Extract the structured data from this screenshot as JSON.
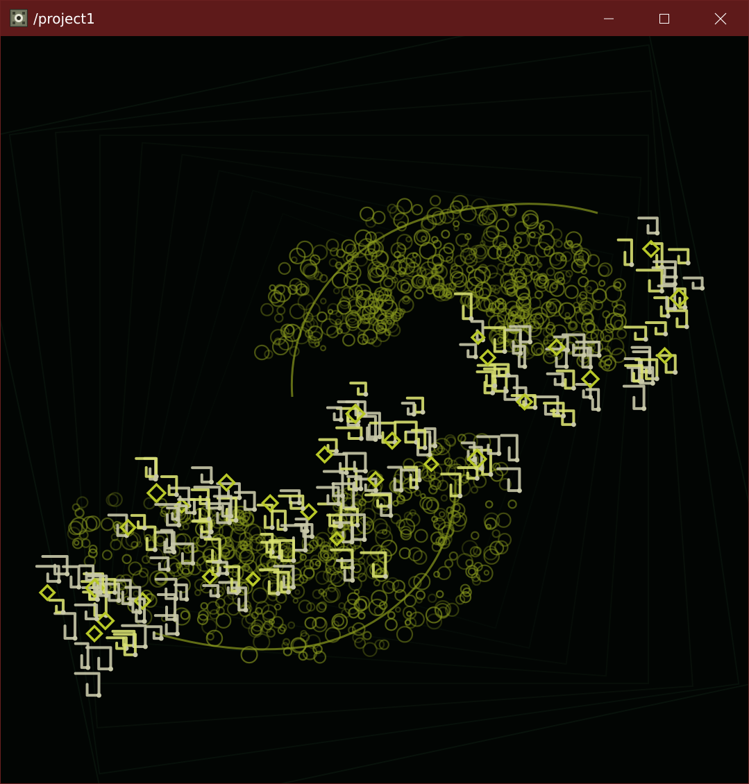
{
  "window": {
    "title": "/project1",
    "controls": {
      "minimize_icon": "minimize-icon",
      "maximize_icon": "maximize-icon",
      "close_icon": "close-icon"
    }
  },
  "theme": {
    "titlebar_color": "#5e1a1a",
    "canvas_background": "#020503",
    "glow_color": "#8a9a1e",
    "bright_color": "#d8e070",
    "pale_color": "#c8c8a8"
  }
}
